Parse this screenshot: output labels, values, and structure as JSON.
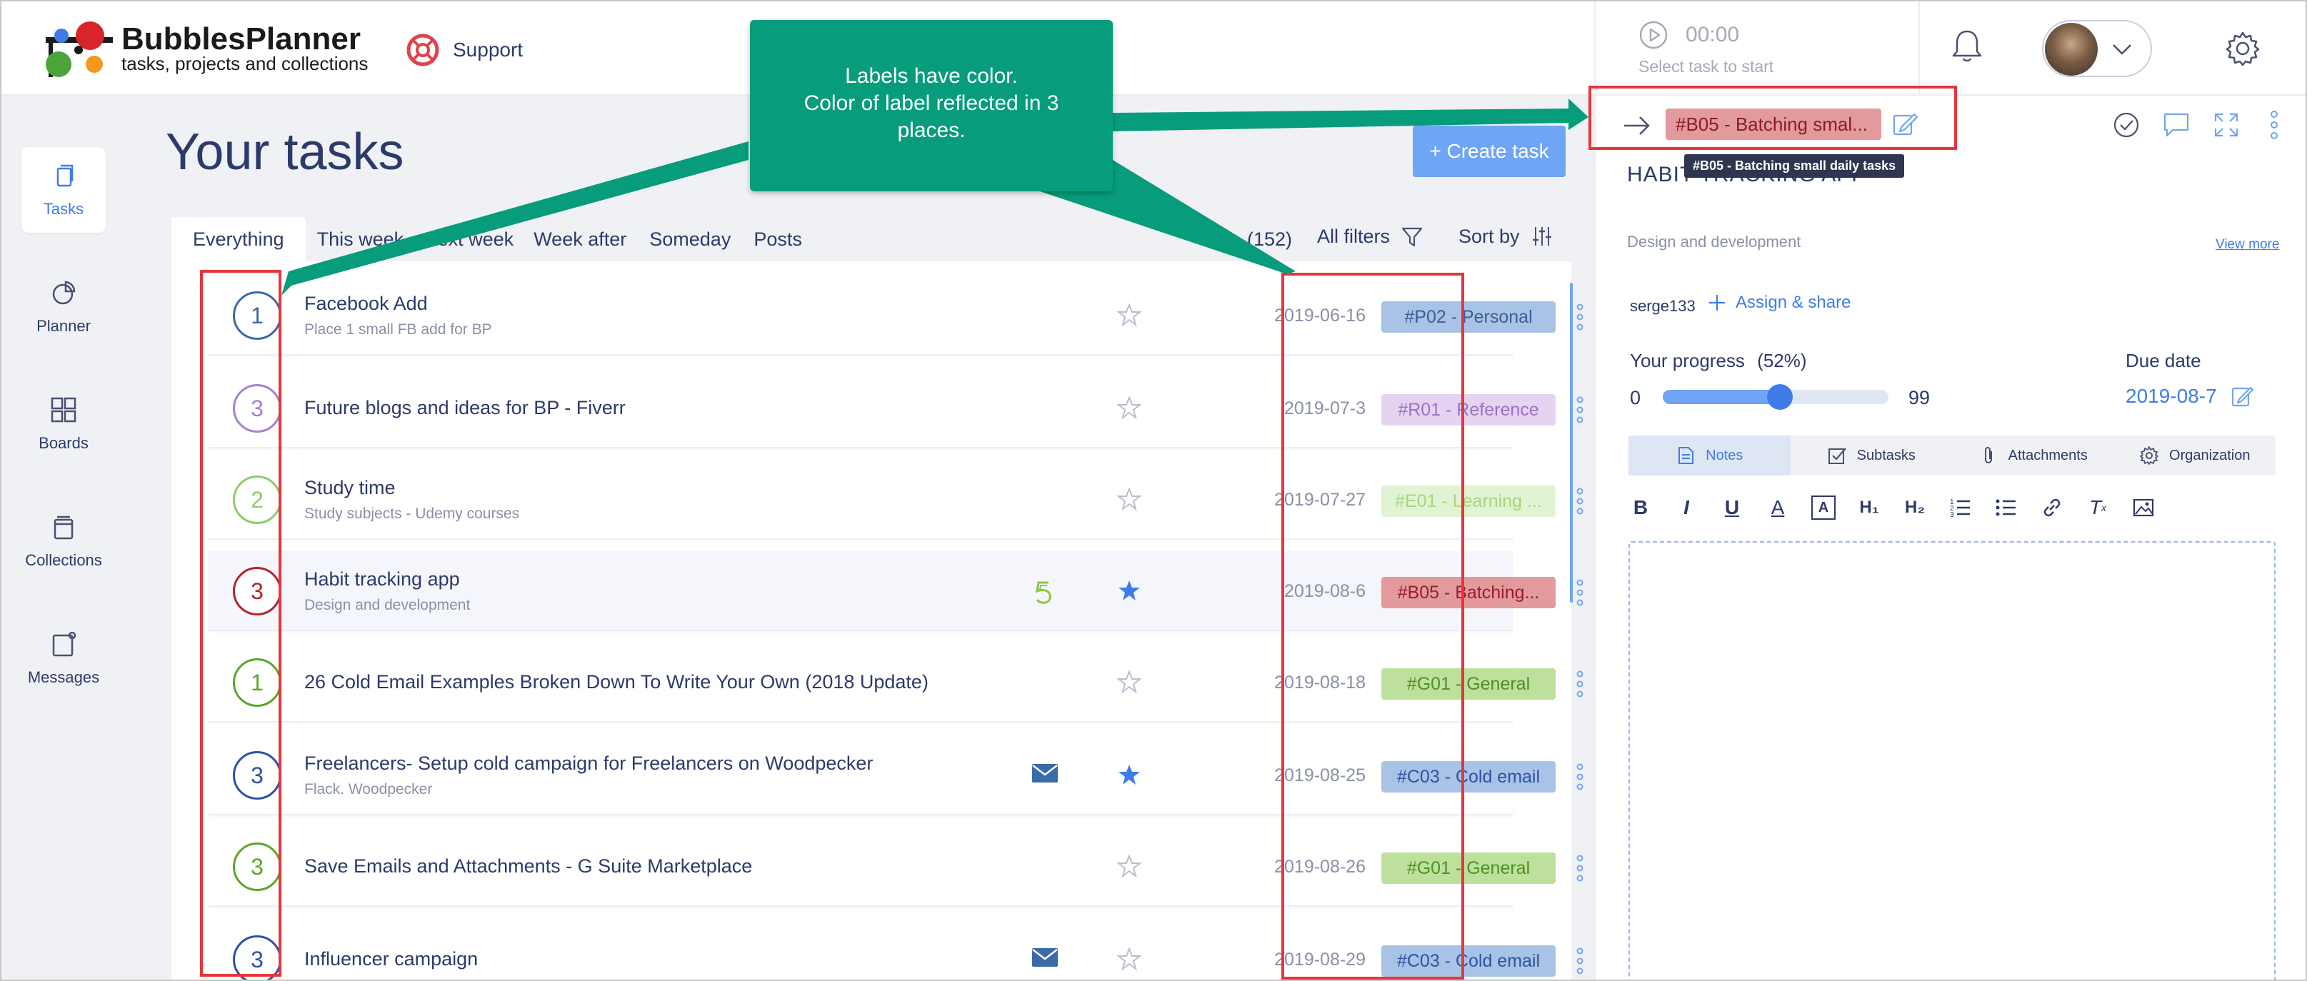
{
  "app": {
    "name": "BubblesPlanner",
    "tagline": "tasks, projects and collections",
    "support_label": "Support"
  },
  "timer": {
    "time": "00:00",
    "hint": "Select task to start"
  },
  "sidebar": {
    "items": [
      {
        "label": "Tasks",
        "icon": "tasks-icon",
        "active": true
      },
      {
        "label": "Planner",
        "icon": "planner-icon",
        "active": false
      },
      {
        "label": "Boards",
        "icon": "boards-icon",
        "active": false
      },
      {
        "label": "Collections",
        "icon": "collections-icon",
        "active": false
      },
      {
        "label": "Messages",
        "icon": "messages-icon",
        "active": false
      }
    ]
  },
  "main": {
    "title": "Your tasks",
    "create_button": "+ Create task",
    "tabs": [
      {
        "label": "Everything",
        "active": true
      },
      {
        "label": "This week"
      },
      {
        "label": "Next week"
      },
      {
        "label": "Week after"
      },
      {
        "label": "Someday"
      },
      {
        "label": "Posts"
      }
    ],
    "count": "(152)",
    "filters_label": "All filters",
    "sort_label": "Sort by"
  },
  "tasks": [
    {
      "priority": "1",
      "color": "#3a6aa8",
      "title": "Facebook Add",
      "subtitle": "Place 1 small FB add for BP",
      "icon": "",
      "starred": false,
      "date": "2019-06-16",
      "label": "#P02 - Personal",
      "label_bg": "#a9c3e6",
      "label_fg": "#3a5f90"
    },
    {
      "priority": "3",
      "color": "#a582cf",
      "title": "Future blogs and ideas for BP - Fiverr",
      "subtitle": "",
      "icon": "",
      "starred": false,
      "date": "2019-07-3",
      "label": "#R01 - Reference",
      "label_bg": "#e4d3f1",
      "label_fg": "#9b73c4"
    },
    {
      "priority": "2",
      "color": "#8dcc6a",
      "title": "Study time",
      "subtitle": "Study subjects - Udemy courses",
      "icon": "",
      "starred": false,
      "date": "2019-07-27",
      "label": "#E01 - Learning ...",
      "label_bg": "#e2f3d3",
      "label_fg": "#a6d57e"
    },
    {
      "priority": "3",
      "color": "#b3242b",
      "title": "Habit tracking app",
      "subtitle": "Design and development",
      "icon": "spiral-5-icon",
      "starred": true,
      "date": "2019-08-6",
      "label": "#B05 - Batching...",
      "label_bg": "#e39a9c",
      "label_fg": "#9a1f26",
      "selected": true
    },
    {
      "priority": "1",
      "color": "#5ba728",
      "title": "26 Cold Email Examples Broken Down To Write Your Own (2018 Update)",
      "subtitle": "",
      "icon": "",
      "starred": false,
      "date": "2019-08-18",
      "label": "#G01 - General",
      "label_bg": "#bde19c",
      "label_fg": "#4f8f25"
    },
    {
      "priority": "3",
      "color": "#2d52a3",
      "title": "Freelancers- Setup cold campaign for Freelancers on Woodpecker",
      "subtitle": "Flack. Woodpecker",
      "icon": "envelope-icon",
      "starred": true,
      "date": "2019-08-25",
      "label": "#C03 - Cold email",
      "label_bg": "#a9c3e6",
      "label_fg": "#2d52a3"
    },
    {
      "priority": "3",
      "color": "#5ba728",
      "title": "Save Emails and Attachments - G Suite Marketplace",
      "subtitle": "",
      "icon": "",
      "starred": false,
      "date": "2019-08-26",
      "label": "#G01 - General",
      "label_bg": "#bde19c",
      "label_fg": "#4f8f25"
    },
    {
      "priority": "3",
      "color": "#2d52a3",
      "title": "Influencer campaign",
      "subtitle": "",
      "icon": "envelope-icon",
      "starred": false,
      "date": "2019-08-29",
      "label": "#C03 - Cold email",
      "label_bg": "#a9c3e6",
      "label_fg": "#2d52a3"
    }
  ],
  "panel": {
    "tag": "#B05 - Batching smal...",
    "tag_tooltip": "#B05 - Batching small daily tasks",
    "project_title": "HABIT TRACKING APP",
    "project_desc": "Design and development",
    "view_more": "View more",
    "owner": "serge133",
    "assign_label": "Assign & share",
    "progress_label": "Your progress",
    "progress_pct_text": "(52%)",
    "progress_value": 0.52,
    "progress_min": "0",
    "progress_max": "99",
    "due_label": "Due date",
    "due_date": "2019-08-7",
    "tabs": [
      {
        "label": "Notes",
        "active": true
      },
      {
        "label": "Subtasks"
      },
      {
        "label": "Attachments"
      },
      {
        "label": "Organization"
      }
    ]
  },
  "annotation": {
    "callout_line1": "Labels have color.",
    "callout_line2": "Color of label reflected in 3",
    "callout_line3": "places.",
    "color": "#079c7b",
    "highlight_color": "#e8353b"
  }
}
